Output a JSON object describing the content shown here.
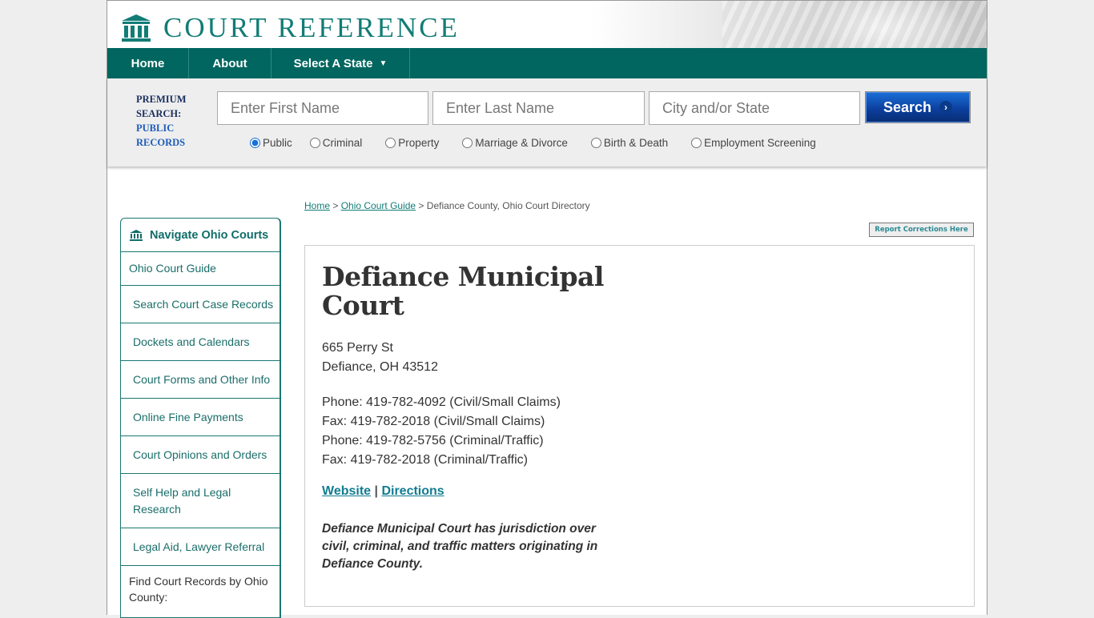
{
  "brand": {
    "name": "COURT REFERENCE",
    "color": "#127c76"
  },
  "nav": {
    "items": [
      {
        "label": "Home"
      },
      {
        "label": "About"
      },
      {
        "label": "Select A State",
        "caret": "▼"
      }
    ]
  },
  "search": {
    "premium_label_1": "PREMIUM",
    "premium_label_2": "SEARCH:",
    "premium_label_3": "PUBLIC",
    "premium_label_4": "RECORDS",
    "first_name_placeholder": "Enter First Name",
    "first_name_value": "",
    "last_name_placeholder": "Enter Last Name",
    "last_name_value": "",
    "city_placeholder": "City and/or State",
    "city_value": "",
    "button_label": "Search",
    "button_icon": "›",
    "record_types": [
      {
        "label": "Public",
        "checked": true
      },
      {
        "label": "Criminal",
        "checked": false
      },
      {
        "label": "Property",
        "checked": false
      },
      {
        "label": "Marriage & Divorce",
        "checked": false
      },
      {
        "label": "Birth & Death",
        "checked": false
      },
      {
        "label": "Employment Screening",
        "checked": false
      }
    ]
  },
  "breadcrumb": {
    "home": "Home",
    "sep": " > ",
    "guide": "Ohio Court Guide",
    "current": "Defiance County, Ohio Court Directory"
  },
  "report_button": "Report Corrections Here",
  "sidebar": {
    "title": "Navigate Ohio Courts",
    "items": [
      {
        "label": "Ohio Court Guide"
      },
      {
        "label": "Search Court Case Records"
      },
      {
        "label": "Dockets and Calendars"
      },
      {
        "label": "Court Forms and Other Info"
      },
      {
        "label": "Online Fine Payments"
      },
      {
        "label": "Court Opinions and Orders"
      },
      {
        "label": "Self Help and Legal Research"
      },
      {
        "label": "Legal Aid, Lawyer Referral"
      }
    ],
    "footer": "Find Court Records by Ohio County:"
  },
  "court": {
    "name": "Defiance Municipal Court",
    "address_line1": "665 Perry St",
    "address_line2": "Defiance, OH 43512",
    "contacts": [
      "Phone: 419-782-4092 (Civil/Small Claims)",
      "Fax: 419-782-2018 (Civil/Small Claims)",
      "Phone: 419-782-5756 (Criminal/Traffic)",
      "Fax: 419-782-2018 (Criminal/Traffic)"
    ],
    "website_label": "Website",
    "link_sep": "|",
    "directions_label": "Directions",
    "description": "Defiance Municipal Court has jurisdiction over civil, criminal, and traffic matters originating in Defiance County."
  }
}
